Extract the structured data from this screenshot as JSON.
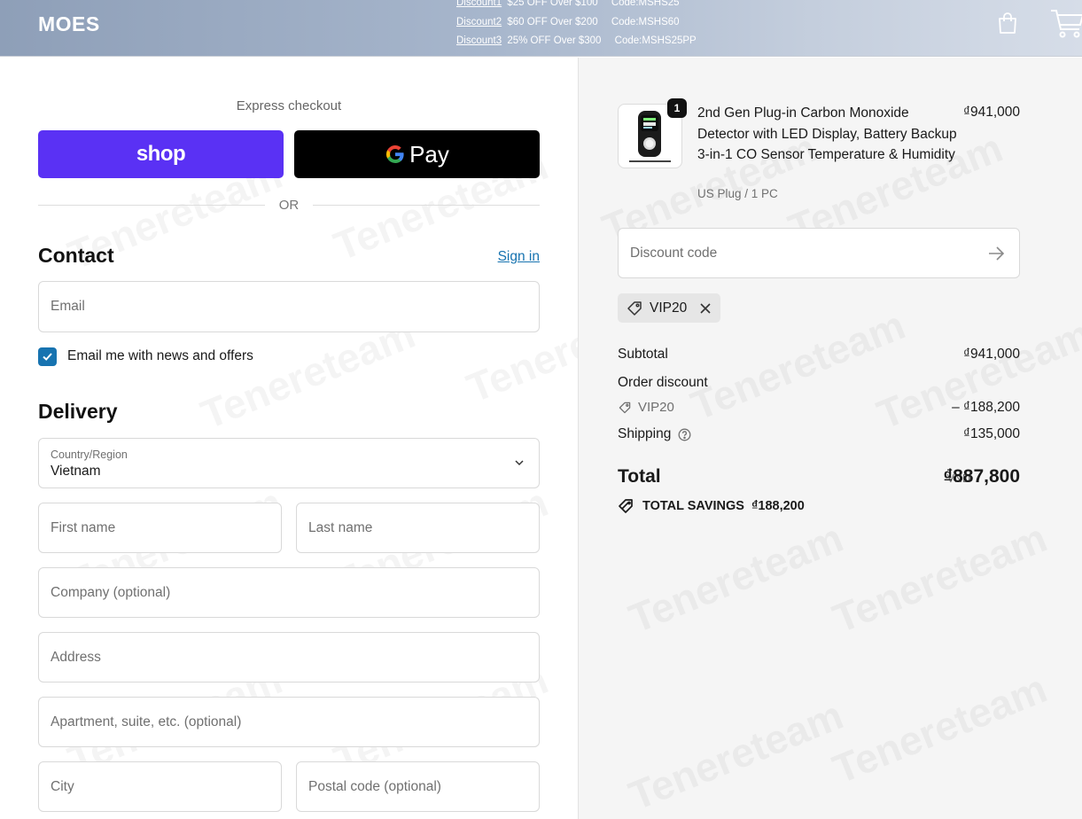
{
  "header": {
    "brand": "MOES",
    "promos": [
      {
        "link": "Discount1",
        "text": "$25 OFF Over $100",
        "code": "Code:MSHS25"
      },
      {
        "link": "Discount2",
        "text": "$60 OFF Over $200",
        "code": "Code:MSHS60"
      },
      {
        "link": "Discount3",
        "text": "25% OFF Over $300",
        "code": "Code:MSHS25PP"
      }
    ],
    "icons": [
      "shopping-bag-icon",
      "cart-icon"
    ]
  },
  "checkout": {
    "express_title": "Express checkout",
    "shop_pay_label": "shop",
    "gpay_label": "Pay",
    "or_text": "OR",
    "contact": {
      "title": "Contact",
      "sign_in": "Sign in",
      "email_placeholder": "Email",
      "newsletter_label": "Email me with news and offers",
      "newsletter_checked": true
    },
    "delivery": {
      "title": "Delivery",
      "country_label": "Country/Region",
      "country_value": "Vietnam",
      "first_name_placeholder": "First name",
      "last_name_placeholder": "Last name",
      "company_placeholder": "Company (optional)",
      "address_placeholder": "Address",
      "apartment_placeholder": "Apartment, suite, etc. (optional)",
      "city_placeholder": "City",
      "postal_placeholder": "Postal code (optional)"
    }
  },
  "summary": {
    "item": {
      "quantity": "1",
      "name": "2nd Gen Plug-in Carbon Monoxide Detector with LED Display, Battery Backup 3-in-1 CO Sensor Temperature & Humidity",
      "variant": "US Plug / 1 PC",
      "price": "₫941,000"
    },
    "discount_placeholder": "Discount code",
    "applied_code": "VIP20",
    "subtotal_label": "Subtotal",
    "subtotal_value": "₫941,000",
    "order_discount_label": "Order discount",
    "discount_code": "VIP20",
    "discount_value": "– ₫188,200",
    "shipping_label": "Shipping",
    "shipping_value": "₫135,000",
    "total_label": "Total",
    "currency": "VND",
    "total_value": "₫887,800",
    "savings_label": "TOTAL SAVINGS",
    "savings_value": "₫188,200"
  },
  "watermark": "Tenereteam",
  "colors": {
    "shop_pay": "#5a31f4",
    "link": "#1773b0",
    "checkbox": "#1773b0"
  }
}
